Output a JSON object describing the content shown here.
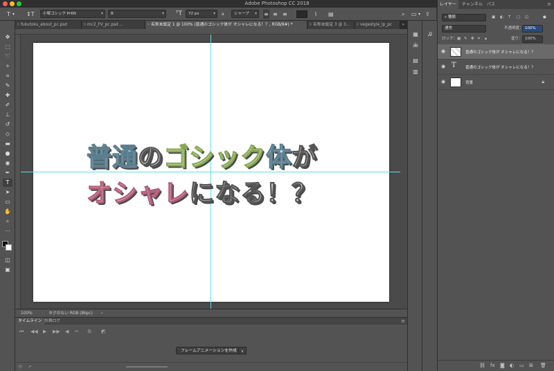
{
  "window": {
    "title": "Adobe Photoshop CC 2018"
  },
  "options_bar": {
    "font_family": "小塚ゴシック Pr6N",
    "font_style": "B",
    "font_size": "72 px",
    "anti_alias_prefix": "a",
    "anti_alias": "シャープ"
  },
  "tabs": [
    {
      "label": "fukutoku_about_pc.psd"
    },
    {
      "label": "mc2_FV_pc.psd ..."
    },
    {
      "label": "名称未設定 1 @ 100% (普通のゴシック体が オシャレになる！？, RGB/8#) *"
    },
    {
      "label": "名称未設定 3 @ 3..."
    },
    {
      "label": "vegestyle_lp_pc"
    }
  ],
  "canvas_text": {
    "line1": [
      {
        "text": "普通",
        "color": "blue"
      },
      {
        "text": "の",
        "color": "gray"
      },
      {
        "text": "ゴシック",
        "color": "green"
      },
      {
        "text": "体",
        "color": "blue"
      },
      {
        "text": "が",
        "color": "gray"
      }
    ],
    "line2": [
      {
        "text": "オシャ",
        "color": "pink"
      },
      {
        "text": "レ",
        "color": "pink"
      },
      {
        "text": "になる！？",
        "color": "gray"
      }
    ]
  },
  "status": {
    "zoom": "100%",
    "profile": "タグのない RGB (8bpc)"
  },
  "timeline": {
    "tabs": [
      "タイムライン",
      "計測ログ"
    ],
    "create_button": "フレームアニメーションを作成"
  },
  "layers_panel": {
    "tabs": [
      "レイヤー",
      "チャンネル",
      "パス"
    ],
    "filter": "種類",
    "blend_mode": "通常",
    "opacity_label": "不透明度：",
    "opacity_value": "100%",
    "lock_label": "ロック：",
    "fill_label": "塗り：",
    "fill_value": "100%",
    "layers": [
      {
        "name": "普通のゴシック体が オシャレになる！？",
        "type": "smart"
      },
      {
        "name": "普通のゴシック体が オシャレになる！？",
        "type": "text"
      },
      {
        "name": "背景",
        "type": "background"
      }
    ]
  },
  "colors": {
    "blue": "#b5e0ee",
    "green": "#d6f5a0",
    "pink": "#f6b6c6",
    "gray": "#ececec",
    "guide": "#5ee0e8"
  },
  "icons": {
    "text_tool": "T",
    "eye": "eye-icon",
    "lock": "lock-icon"
  }
}
